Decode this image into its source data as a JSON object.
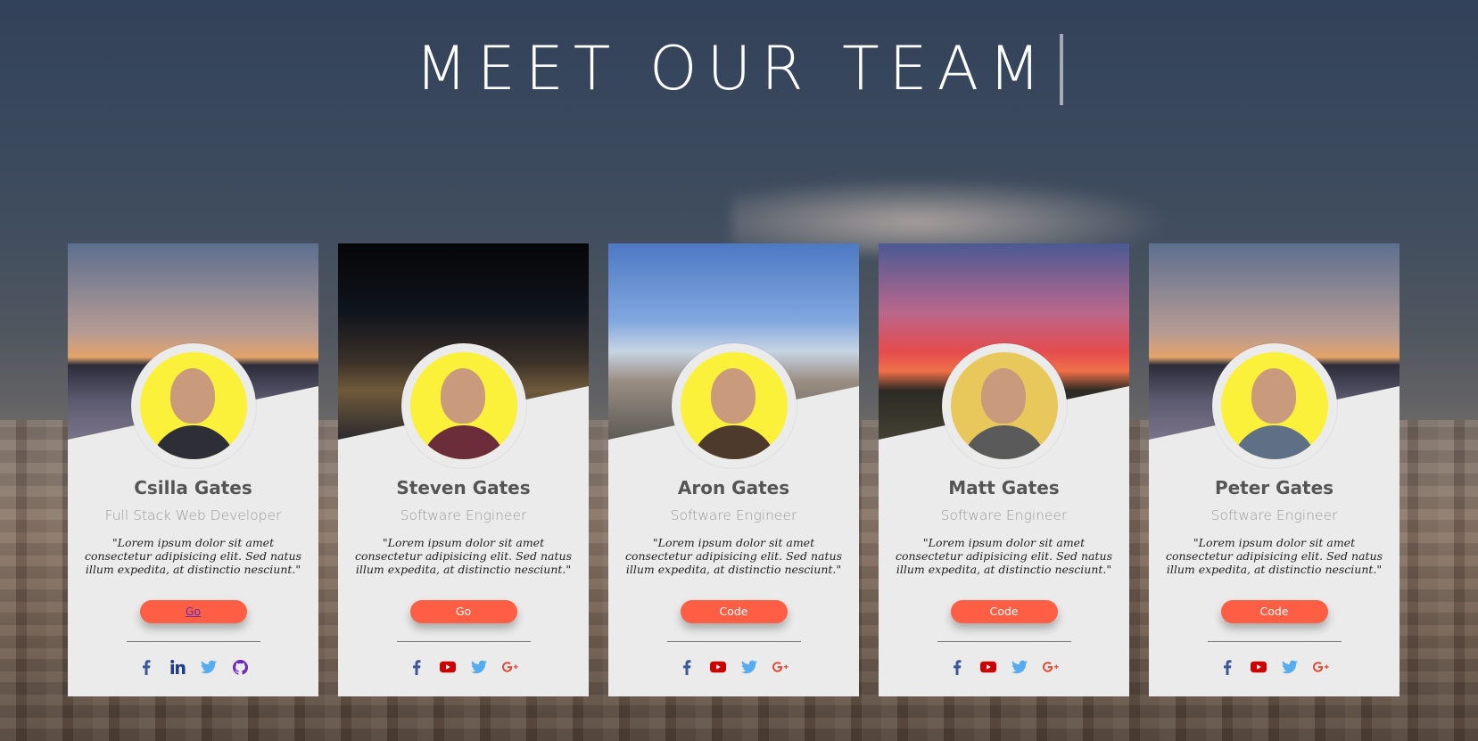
{
  "page": {
    "title": "MEET OUR TEAM"
  },
  "colors": {
    "accent": "#fd5e44",
    "card_bg": "#ebebeb",
    "avatar_bg": "#fbf03a",
    "facebook": "#3b5998",
    "linkedin": "#1f3c88",
    "twitter": "#55acee",
    "github": "#6a2bb0",
    "youtube": "#cc0000",
    "gplus": "#dd4b39"
  },
  "team": [
    {
      "name": "Csilla Gates",
      "role": "Full Stack Web Developer",
      "quote": "\"Lorem ipsum dolor sit amet consectetur adipisicing elit. Sed natus illum expedita, at distinctio nesciunt.\"",
      "button": "Go",
      "socials": [
        "facebook-icon",
        "linkedin-icon",
        "twitter-icon",
        "github-icon"
      ]
    },
    {
      "name": "Steven Gates",
      "role": "Software Engineer",
      "quote": "\"Lorem ipsum dolor sit amet consectetur adipisicing elit. Sed natus illum expedita, at distinctio nesciunt.\"",
      "button": "Go",
      "socials": [
        "facebook-icon",
        "youtube-icon",
        "twitter-icon",
        "google-plus-icon"
      ]
    },
    {
      "name": "Aron Gates",
      "role": "Software Engineer",
      "quote": "\"Lorem ipsum dolor sit amet consectetur adipisicing elit. Sed natus illum expedita, at distinctio nesciunt.\"",
      "button": "Code",
      "socials": [
        "facebook-icon",
        "youtube-icon",
        "twitter-icon",
        "google-plus-icon"
      ]
    },
    {
      "name": "Matt Gates",
      "role": "Software Engineer",
      "quote": "\"Lorem ipsum dolor sit amet consectetur adipisicing elit. Sed natus illum expedita, at distinctio nesciunt.\"",
      "button": "Code",
      "socials": [
        "facebook-icon",
        "youtube-icon",
        "twitter-icon",
        "google-plus-icon"
      ]
    },
    {
      "name": "Peter Gates",
      "role": "Software Engineer",
      "quote": "\"Lorem ipsum dolor sit amet consectetur adipisicing elit. Sed natus illum expedita, at distinctio nesciunt.\"",
      "button": "Code",
      "socials": [
        "facebook-icon",
        "youtube-icon",
        "twitter-icon",
        "google-plus-icon"
      ]
    }
  ]
}
